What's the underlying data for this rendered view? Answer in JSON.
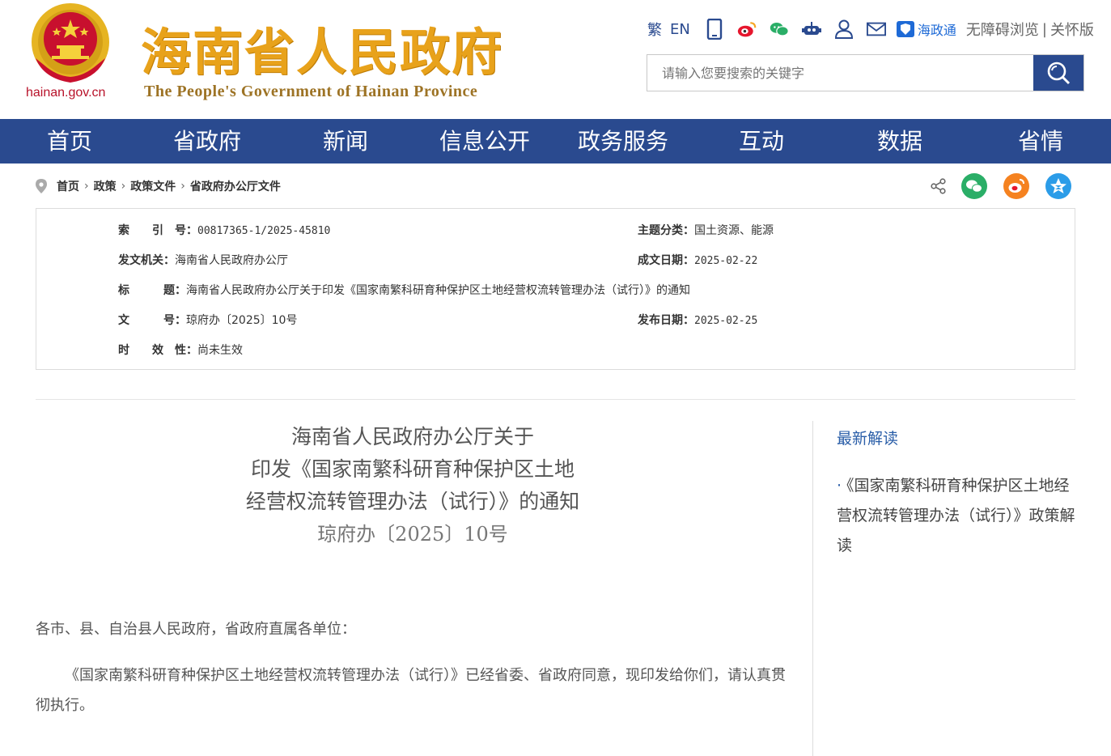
{
  "site": {
    "domain": "hainan.gov.cn",
    "title": "海南省人民政府",
    "subtitle": "The People's Government  of Hainan Province"
  },
  "toolbar": {
    "traditional": "繁",
    "english": "EN",
    "haizhengtong": "海政通",
    "accessible": "无障碍浏览",
    "separator": "|",
    "elder": "关怀版"
  },
  "search": {
    "placeholder": "请输入您要搜索的关键字"
  },
  "nav": [
    "首页",
    "省政府",
    "新闻",
    "信息公开",
    "政务服务",
    "互动",
    "数据",
    "省情"
  ],
  "breadcrumb": [
    "首页",
    "政策",
    "政策文件",
    "省政府办公厅文件"
  ],
  "meta": {
    "index_label": "索　　引　号：",
    "index_value": "00817365-1/2025-45810",
    "topic_label": "主题分类：",
    "topic_value": "国土资源、能源",
    "issuer_label": "发文机关：",
    "issuer_value": "海南省人民政府办公厅",
    "date_label": "成文日期：",
    "date_value": "2025-02-22",
    "title_label": "标　　　题：",
    "title_value": "海南省人民政府办公厅关于印发《国家南繁科研育种保护区土地经营权流转管理办法（试行）》的通知",
    "docno_label": "文　　　号：",
    "docno_value": "琼府办〔2025〕10号",
    "pub_label": "发布日期：",
    "pub_value": "2025-02-25",
    "validity_label": "时　　效　性：",
    "validity_value": "尚未生效"
  },
  "article": {
    "title_line1": "海南省人民政府办公厅关于",
    "title_line2": "印发《国家南繁科研育种保护区土地",
    "title_line3": "经营权流转管理办法（试行）》的通知",
    "doc_number": "琼府办〔2025〕10号",
    "salutation": "各市、县、自治县人民政府，省政府直属各单位：",
    "body": "《国家南繁科研育种保护区土地经营权流转管理办法（试行）》已经省委、省政府同意，现印发给你们，请认真贯彻执行。"
  },
  "sidebar": {
    "title": "最新解读",
    "items": [
      {
        "dot": "·",
        "text": "《国家南繁科研育种保护区土地经营权流转管理办法（试行）》政策解读"
      }
    ]
  },
  "colors": {
    "nav_bg": "#2a4a8f",
    "title_gold": "#e8a21b",
    "link_blue": "#2a5ea8",
    "emblem_red": "#c8102e"
  }
}
